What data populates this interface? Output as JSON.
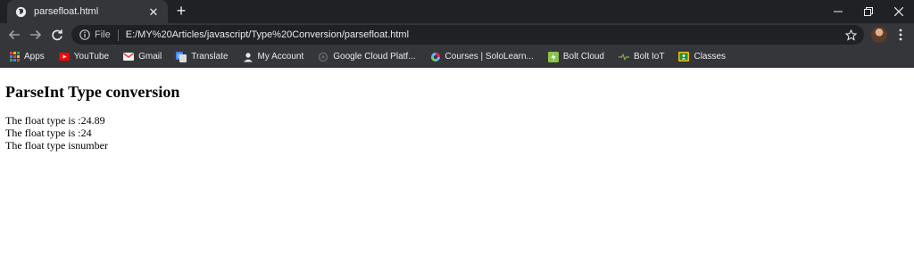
{
  "browser": {
    "tab": {
      "title": "parsefloat.html"
    },
    "address": {
      "scheme_label": "File",
      "url": "E:/MY%20Articles/javascript/Type%20Conversion/parsefloat.html"
    },
    "bookmarks": [
      {
        "label": "Apps",
        "icon": "apps-grid-icon"
      },
      {
        "label": "YouTube",
        "icon": "youtube-icon"
      },
      {
        "label": "Gmail",
        "icon": "gmail-icon"
      },
      {
        "label": "Translate",
        "icon": "translate-icon"
      },
      {
        "label": "My Account",
        "icon": "account-icon"
      },
      {
        "label": "Google Cloud Platf...",
        "icon": "cloud-icon"
      },
      {
        "label": "Courses | SoloLearn...",
        "icon": "sololearn-icon"
      },
      {
        "label": "Bolt Cloud",
        "icon": "bolt-cloud-icon"
      },
      {
        "label": "Bolt IoT",
        "icon": "bolt-iot-icon"
      },
      {
        "label": "Classes",
        "icon": "classroom-icon"
      }
    ]
  },
  "page": {
    "heading": "ParseInt Type conversion",
    "lines": [
      "The float type is :24.89",
      "The float type is :24",
      "The float type isnumber"
    ]
  },
  "colors": {
    "tab_strip": "#202124",
    "toolbar": "#35363a",
    "omnibox": "#202124",
    "text_light": "#e8eaed"
  }
}
